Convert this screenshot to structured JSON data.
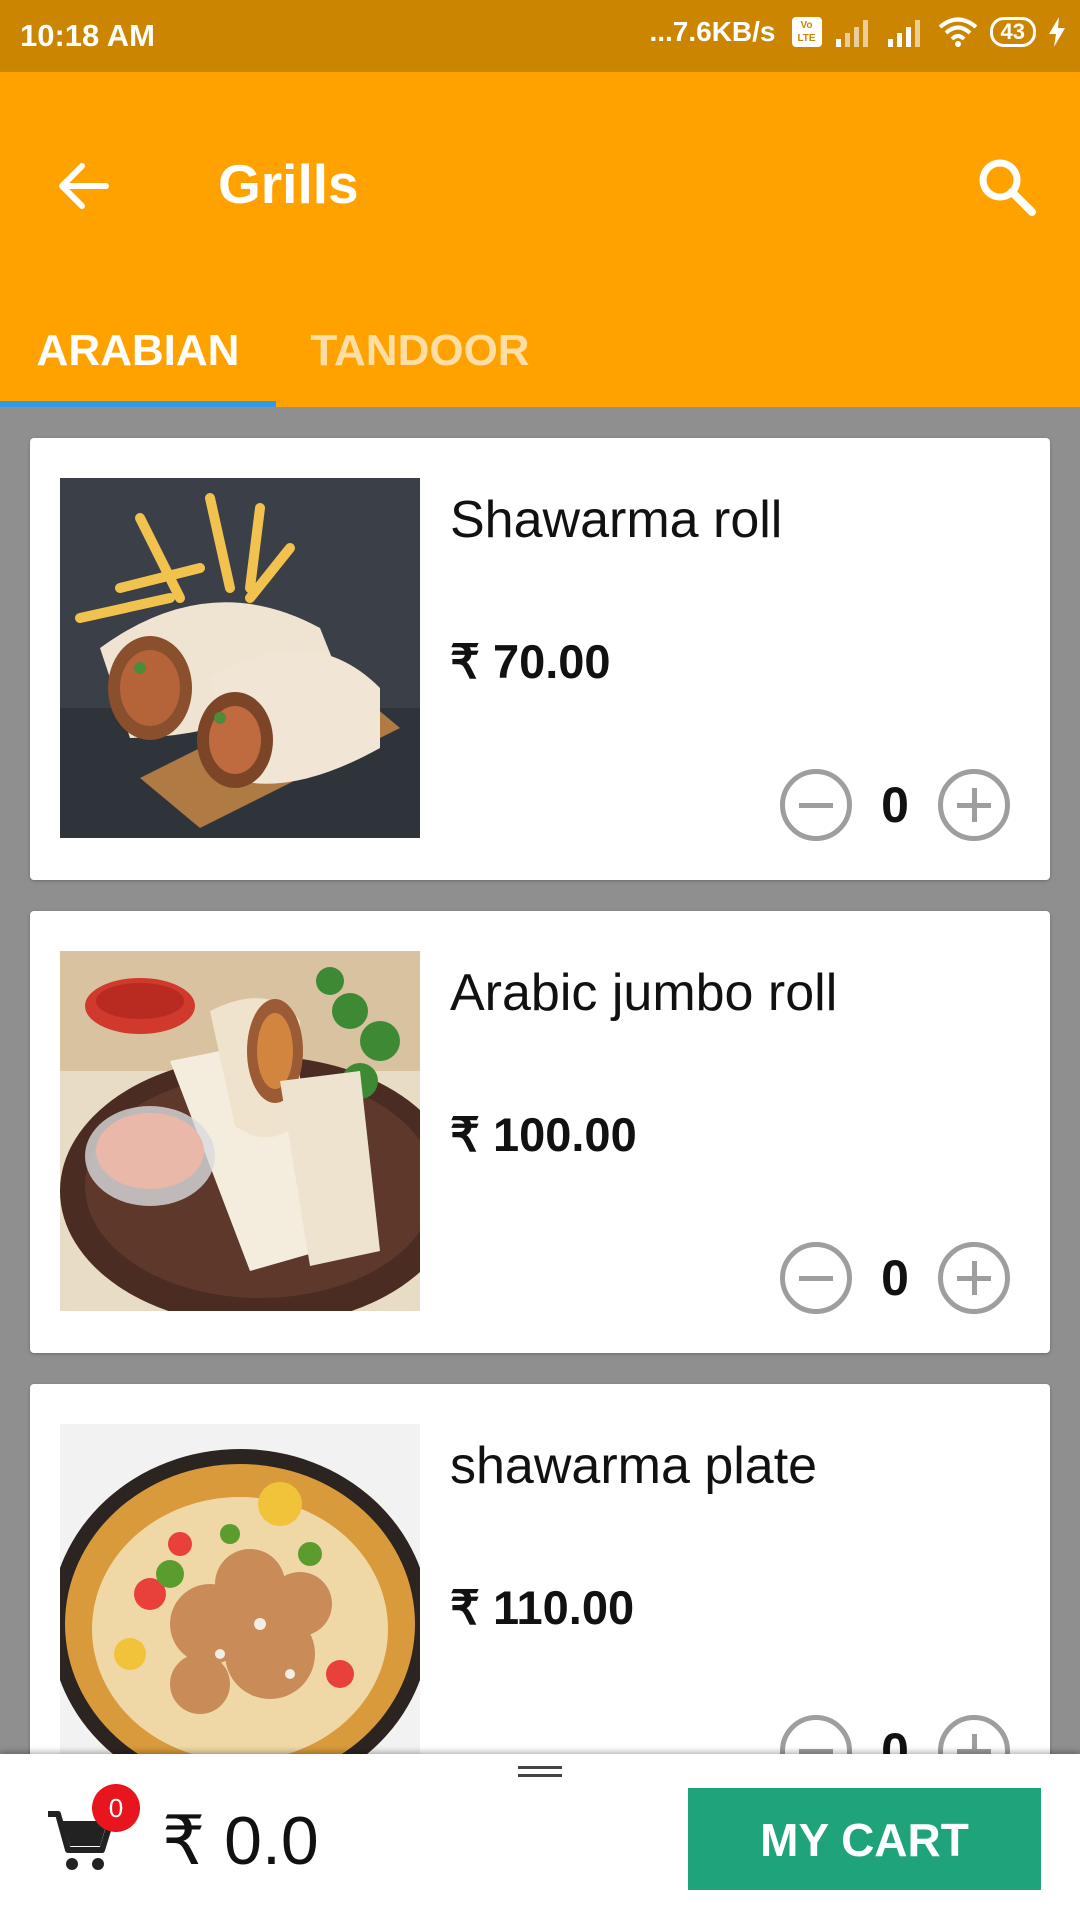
{
  "status_bar": {
    "time": "10:18 AM",
    "network_speed": "...7.6KB/s",
    "volte": "Vo LTE",
    "battery": "43"
  },
  "toolbar": {
    "title": "Grills",
    "back_icon": "arrow-left-icon",
    "search_icon": "search-icon"
  },
  "tabs": [
    {
      "label": "ARABIAN",
      "active": true
    },
    {
      "label": "TANDOOR",
      "active": false
    }
  ],
  "items": [
    {
      "name": "Shawarma roll",
      "price": "₹ 70.00",
      "qty": "0"
    },
    {
      "name": "Arabic jumbo roll",
      "price": "₹ 100.00",
      "qty": "0"
    },
    {
      "name": "shawarma plate",
      "price": "₹ 110.00",
      "qty": "0"
    }
  ],
  "cart": {
    "badge": "0",
    "total": "₹ 0.0",
    "button_label": "MY CART"
  },
  "colors": {
    "status_bar": "#cb8500",
    "app_bar": "#ffa200",
    "tab_indicator": "#2f9be8",
    "cart_button": "#1fa37a",
    "badge": "#e8141e"
  }
}
